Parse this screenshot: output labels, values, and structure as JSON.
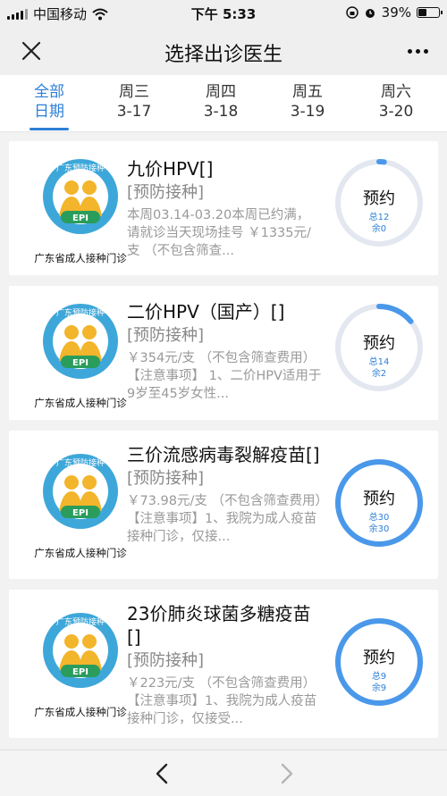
{
  "status_bar": {
    "carrier": "中国移动",
    "time": "下午 5:33",
    "battery": "39%"
  },
  "nav": {
    "title": "选择出诊医生",
    "close_icon": "close-icon",
    "more_icon": "more-icon"
  },
  "tabs": [
    {
      "line1": "全部",
      "line2": "日期",
      "active": true
    },
    {
      "line1": "周三",
      "line2": "3-17"
    },
    {
      "line1": "周四",
      "line2": "3-18"
    },
    {
      "line1": "周五",
      "line2": "3-19"
    },
    {
      "line1": "周六",
      "line2": "3-20"
    }
  ],
  "logo": {
    "arc_text": "广东预防接种",
    "badge": "EPI",
    "caption": "广东省成人接种门诊"
  },
  "items": [
    {
      "name": "九价HPV[]",
      "category": "[预防接种]",
      "description": "本周03.14-03.20本周已约满，请就诊当天现场挂号 ￥1335元/支 （不包含筛查...",
      "book_label": "预约",
      "total": "总12",
      "remaining": "余0",
      "booked_fraction": 0.02
    },
    {
      "name": "二价HPV（国产）[]",
      "category": "[预防接种]",
      "description": "￥354元/支 （不包含筛查费用） 【注意事项】 1、二价HPV适用于9岁至45岁女性...",
      "book_label": "预约",
      "total": "总14",
      "remaining": "余2",
      "booked_fraction": 0.14
    },
    {
      "name": "三价流感病毒裂解疫苗[]",
      "category": "[预防接种]",
      "description": "￥73.98元/支 （不包含筛查费用）【注意事项】1、我院为成人疫苗接种门诊，仅接...",
      "book_label": "预约",
      "total": "总30",
      "remaining": "余30",
      "booked_fraction": 1.0
    },
    {
      "name": "23价肺炎球菌多糖疫苗[]",
      "category": "[预防接种]",
      "description": "￥223元/支 （不包含筛查费用）【注意事项】1、我院为成人疫苗接种门诊，仅接受...",
      "book_label": "预约",
      "total": "总9",
      "remaining": "余9",
      "booked_fraction": 1.0
    }
  ],
  "colors": {
    "accent": "#2d7fd6",
    "ring_track": "#e3e7f0",
    "ring_fill": "#4a98ea"
  },
  "bottom": {
    "back_icon": "chevron-left-icon",
    "forward_icon": "chevron-right-icon"
  }
}
